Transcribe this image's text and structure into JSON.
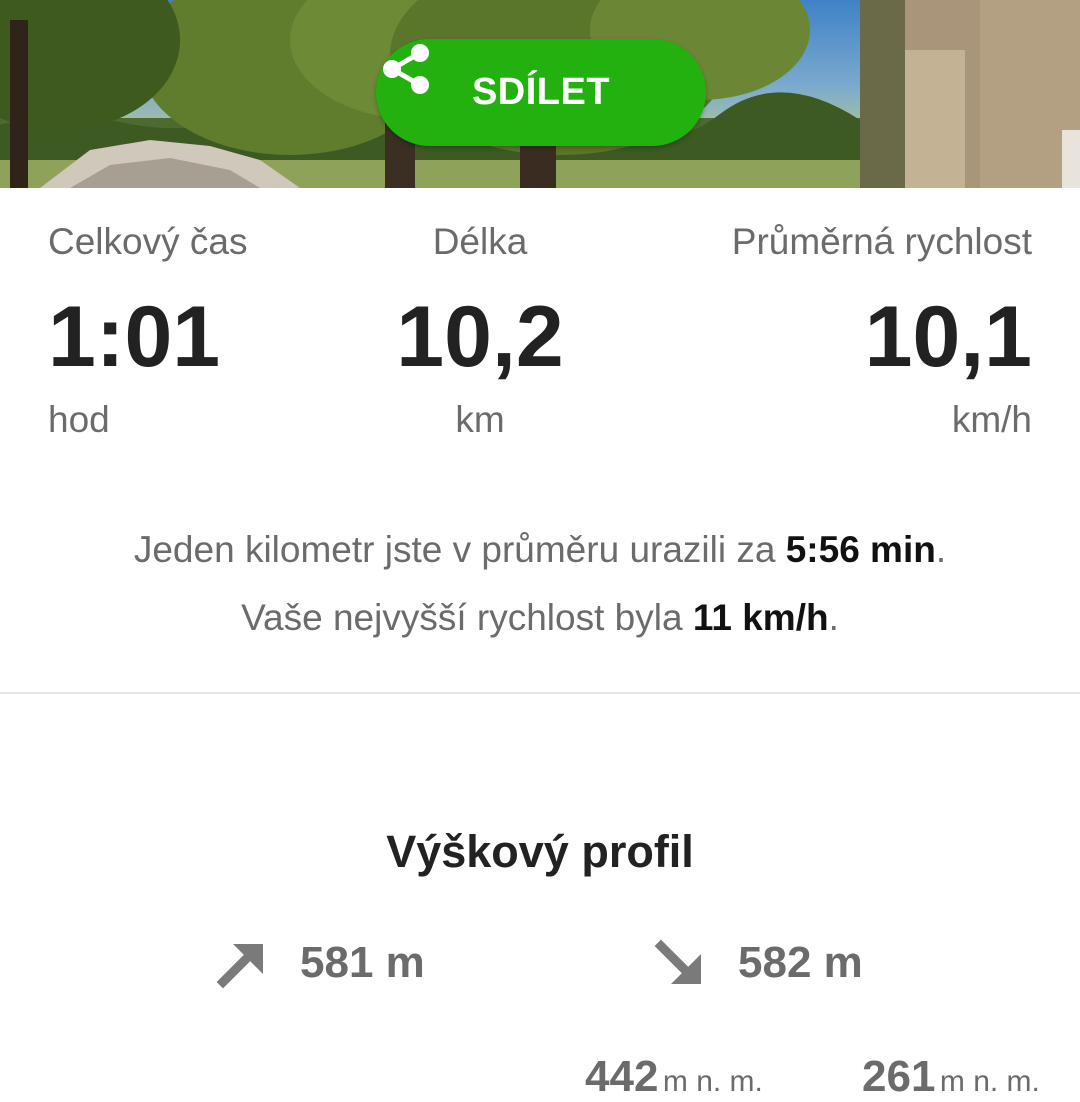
{
  "share": {
    "label": "SDÍLET",
    "icon": "share-icon",
    "color": "#22b10f"
  },
  "stats": [
    {
      "label": "Celkový čas",
      "value": "1:01",
      "unit": "hod"
    },
    {
      "label": "Délka",
      "value": "10,2",
      "unit": "km"
    },
    {
      "label": "Průměrná rychlost",
      "value": "10,1",
      "unit": "km/h"
    }
  ],
  "summary": {
    "line1_prefix": "Jeden kilometr jste v průměru urazili za ",
    "line1_value": "5:56 min",
    "line1_suffix": ".",
    "line2_prefix": "Vaše nejvyšší rychlost byla ",
    "line2_value": "11 km/h",
    "line2_suffix": "."
  },
  "elevation": {
    "title": "Výškový profil",
    "ascent": "581 m",
    "descent": "582 m",
    "max_altitude": {
      "value": "442",
      "unit": "m n. m."
    },
    "min_altitude": {
      "value": "261",
      "unit": "m n. m."
    }
  }
}
